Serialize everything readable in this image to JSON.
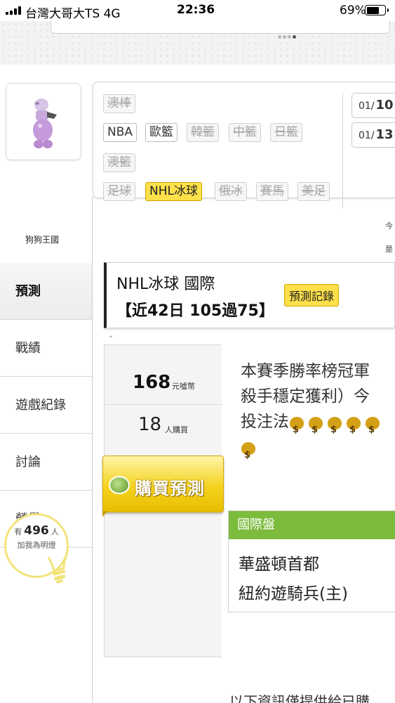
{
  "statusbar": {
    "carrier": "台灣大哥大TS  4G",
    "time": "22:36",
    "battery": "69%"
  },
  "profile": {
    "username": "狗狗王國"
  },
  "nav": {
    "items": [
      {
        "label": "預測"
      },
      {
        "label": "戰績"
      },
      {
        "label": "遊戲紀錄"
      },
      {
        "label": "討論"
      },
      {
        "label": "榮譽"
      }
    ]
  },
  "fans": {
    "prefix": "有",
    "count": "496",
    "suffix": "人",
    "caption": "加我為明燈"
  },
  "filters": {
    "row1": [
      "澳棒"
    ],
    "row2": [
      "NBA",
      "歐籃",
      "韓籃",
      "中籃",
      "日籃"
    ],
    "row3": [
      "澳籃"
    ],
    "row4": [
      "足球",
      "NHL冰球",
      "俄冰",
      "賽馬",
      "美足"
    ]
  },
  "dates": {
    "d1_prefix": "01/",
    "d1_day": "10",
    "d2_prefix": "01/",
    "d2_day": "13",
    "hint1": "今",
    "hint2": "是"
  },
  "prediction": {
    "title": "NHL冰球 國際",
    "record": "【近42日 105過75】",
    "record_button": "預測記錄",
    "price": "168",
    "price_unit": "元噓幣",
    "buyers": "18",
    "buyers_unit": "人購買",
    "buy_button": "購買預測",
    "desc_line1": "本賽季勝率榜冠軍",
    "desc_line2": "殺手穩定獲利）今",
    "desc_line3": "投注法"
  },
  "game": {
    "market": "國際盤",
    "team1": "華盛頓首都",
    "team2": "紐約遊騎兵(主)"
  },
  "footer": {
    "text": "以下資訊僅提供給已購"
  }
}
